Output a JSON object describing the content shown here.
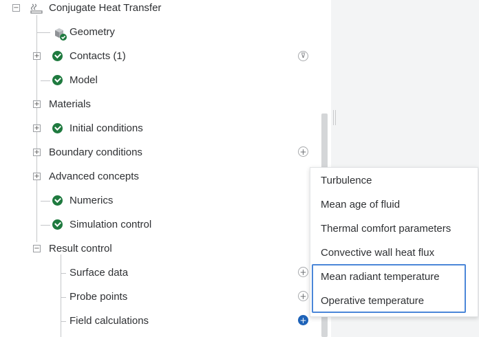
{
  "tree": {
    "root": {
      "label": "Conjugate Heat Transfer",
      "expander": "−",
      "icon": "heat-transfer-icon"
    },
    "items": [
      {
        "label": "Geometry",
        "icon": "geometry-cube-icon"
      },
      {
        "label": "Contacts (1)",
        "expander": "+",
        "status": "check"
      },
      {
        "label": "Model",
        "status": "check"
      },
      {
        "label": "Materials",
        "expander": "+"
      },
      {
        "label": "Initial conditions",
        "expander": "+",
        "status": "check"
      },
      {
        "label": "Boundary conditions",
        "expander": "+"
      },
      {
        "label": "Advanced concepts",
        "expander": "+"
      },
      {
        "label": "Numerics",
        "status": "check"
      },
      {
        "label": "Simulation control",
        "status": "check"
      },
      {
        "label": "Result control",
        "expander": "−"
      }
    ],
    "result_children": [
      {
        "label": "Surface data"
      },
      {
        "label": "Probe points"
      },
      {
        "label": "Field calculations"
      }
    ],
    "filter_glyph": "⊽",
    "add_glyph": "+"
  },
  "dropdown": {
    "items": [
      "Turbulence",
      "Mean age of fluid",
      "Thermal comfort parameters",
      "Convective wall heat flux",
      "Mean radiant temperature",
      "Operative temperature"
    ]
  },
  "colors": {
    "check_green": "#1f7a3f",
    "accent_blue": "#1e63b8",
    "highlight_border": "#4a86d8",
    "right_pane": "#f3f4f5"
  }
}
